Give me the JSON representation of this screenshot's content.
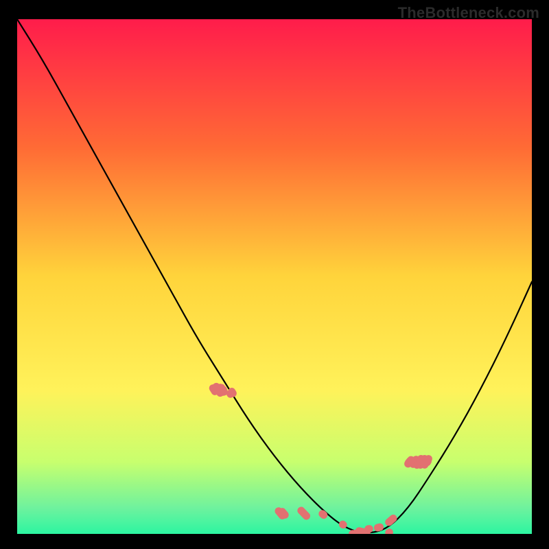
{
  "watermark": "TheBottleneck.com",
  "chart_data": {
    "type": "line",
    "title": "",
    "xlabel": "",
    "ylabel": "",
    "xlim": [
      0,
      100
    ],
    "ylim": [
      0,
      100
    ],
    "background_gradient": {
      "direction": "vertical",
      "stops": [
        {
          "pct": 0,
          "color": "#ff1c4b"
        },
        {
          "pct": 25,
          "color": "#ff6b35"
        },
        {
          "pct": 50,
          "color": "#ffd43b"
        },
        {
          "pct": 72,
          "color": "#fff25a"
        },
        {
          "pct": 86,
          "color": "#c8ff6e"
        },
        {
          "pct": 95,
          "color": "#6ef29e"
        },
        {
          "pct": 100,
          "color": "#2cf5a1"
        }
      ]
    },
    "series": [
      {
        "name": "bottleneck-curve",
        "color": "#000000",
        "x": [
          0,
          5,
          10,
          15,
          20,
          25,
          30,
          35,
          40,
          45,
          50,
          55,
          60,
          64,
          68,
          72,
          76,
          80,
          85,
          90,
          95,
          100
        ],
        "values": [
          100,
          92,
          83,
          74,
          65,
          56,
          47,
          38,
          30,
          22,
          15,
          9,
          4,
          1,
          0,
          1,
          5,
          11,
          19,
          28,
          38,
          49
        ]
      }
    ],
    "scatter_bands": [
      {
        "name": "left-band",
        "color": "#e27171",
        "x_range": [
          38,
          42
        ],
        "y_range": [
          19,
          28
        ]
      },
      {
        "name": "bottom-band",
        "color": "#e27171",
        "x_range": [
          50,
          73
        ],
        "y_range": [
          0,
          4
        ]
      },
      {
        "name": "right-band",
        "color": "#e27171",
        "x_range": [
          76,
          80
        ],
        "y_range": [
          14,
          24
        ]
      }
    ]
  }
}
